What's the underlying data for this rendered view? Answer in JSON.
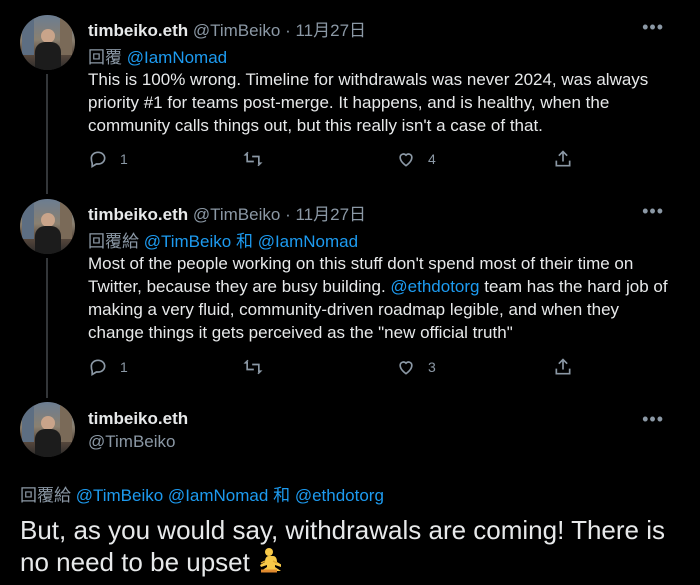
{
  "tweets": [
    {
      "name": "timbeiko.eth",
      "handle": "@TimBeiko",
      "date": "· 11月27日",
      "reply_prefix": "回覆",
      "reply_mentions": [
        "@IamNomad"
      ],
      "text": "This is 100% wrong. Timeline for withdrawals was never 2024, was always priority #1 for teams post-merge. It happens, and is healthy, when the community calls things out, but this really isn't a case of that.",
      "replies": "1",
      "retweets": "",
      "likes": "4"
    },
    {
      "name": "timbeiko.eth",
      "handle": "@TimBeiko",
      "date": "· 11月27日",
      "reply_prefix": "回覆給",
      "reply_mentions": [
        "@TimBeiko",
        "和",
        "@IamNomad"
      ],
      "text_before": "Most of the people working on this stuff don't spend most of their time on Twitter, because they are busy building. ",
      "text_link": "@ethdotorg",
      "text_after": " team has the hard job of making a very fluid, community-driven roadmap legible, and when they change things it gets perceived as the \"new official truth\"",
      "replies": "1",
      "retweets": "",
      "likes": "3"
    },
    {
      "name": "timbeiko.eth",
      "handle": "@TimBeiko",
      "reply_prefix": "回覆給",
      "reply_mentions": [
        "@TimBeiko @IamNomad",
        "和",
        "@ethdotorg"
      ],
      "text": "But, as you would say, withdrawals are coming! There is no need to be upset"
    }
  ],
  "icons": {
    "reply": "reply-icon",
    "retweet": "retweet-icon",
    "like": "heart-icon",
    "share": "share-icon",
    "more": "more-icon",
    "emoji": "person-in-lotus-position-emoji"
  },
  "colors": {
    "background": "#000000",
    "text": "#e7e9ea",
    "muted": "#8b98a5",
    "link": "#1d9bf0"
  }
}
